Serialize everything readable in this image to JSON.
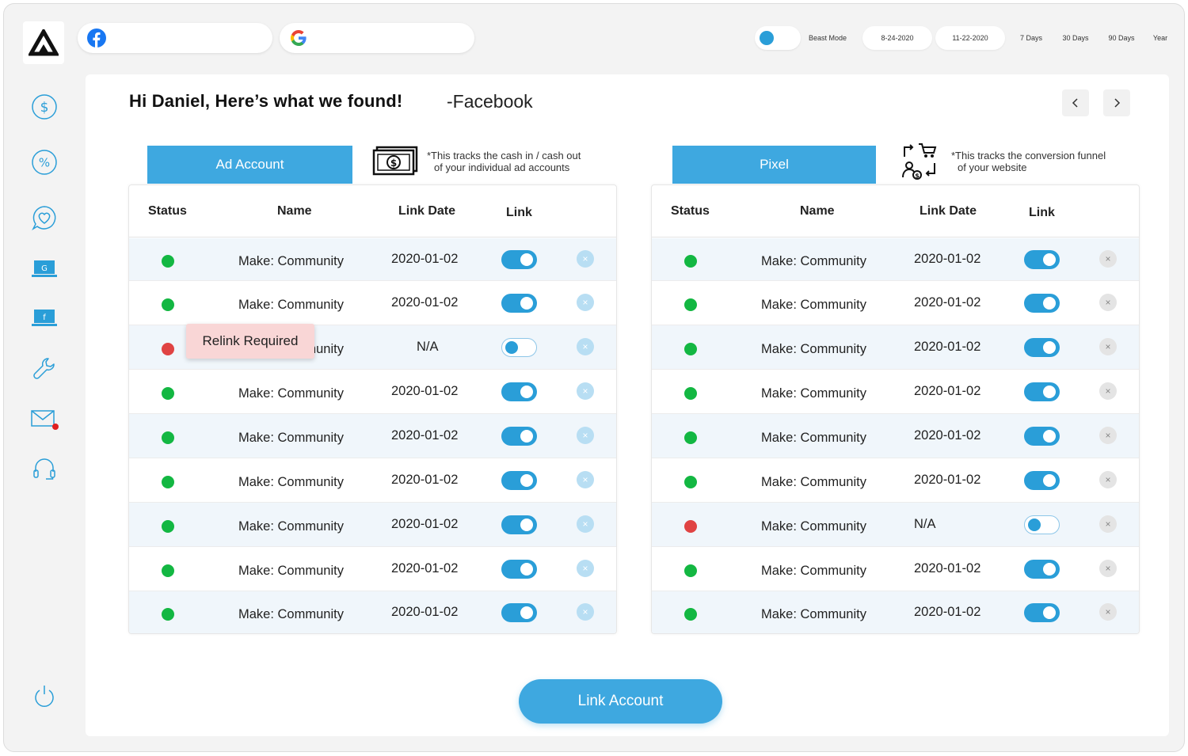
{
  "topbar": {
    "beast_mode_label": "Beast Mode",
    "date_start": "8-24-2020",
    "date_end": "11-22-2020",
    "ranges": [
      "7 Days",
      "30 Days",
      "90 Days",
      "Year"
    ]
  },
  "sidebar": {
    "items": [
      "dollar-icon",
      "percent-icon",
      "heart-chat-icon",
      "google-ads-icon",
      "facebook-ads-icon",
      "wrench-icon",
      "mail-icon",
      "headset-icon"
    ],
    "bottom": "power-icon"
  },
  "header": {
    "greeting": "Hi Daniel, Here’s what we found!",
    "platform": "-Facebook"
  },
  "ad_account": {
    "tab_label": "Ad Account",
    "note_line1": "*This tracks the cash in / cash out",
    "note_line2": "of your individual ad accounts",
    "columns": [
      "Status",
      "Name",
      "Link Date",
      "Link"
    ],
    "tooltip": "Relink Required",
    "rows": [
      {
        "status": "green",
        "name": "Make: Community",
        "date": "2020-01-02",
        "linked": true
      },
      {
        "status": "green",
        "name": "Make: Community",
        "date": "2020-01-02",
        "linked": true
      },
      {
        "status": "red",
        "name": "Make: Community",
        "date": "N/A",
        "linked": false
      },
      {
        "status": "green",
        "name": "Make: Community",
        "date": "2020-01-02",
        "linked": true
      },
      {
        "status": "green",
        "name": "Make: Community",
        "date": "2020-01-02",
        "linked": true
      },
      {
        "status": "green",
        "name": "Make: Community",
        "date": "2020-01-02",
        "linked": true
      },
      {
        "status": "green",
        "name": "Make: Community",
        "date": "2020-01-02",
        "linked": true
      },
      {
        "status": "green",
        "name": "Make: Community",
        "date": "2020-01-02",
        "linked": true
      },
      {
        "status": "green",
        "name": "Make: Community",
        "date": "2020-01-02",
        "linked": true
      }
    ]
  },
  "pixel": {
    "tab_label": "Pixel",
    "note_line1": "*This tracks the conversion funnel",
    "note_line2": "of your website",
    "columns": [
      "Status",
      "Name",
      "Link Date",
      "Link"
    ],
    "rows": [
      {
        "status": "green",
        "name": "Make: Community",
        "date": "2020-01-02",
        "linked": true
      },
      {
        "status": "green",
        "name": "Make: Community",
        "date": "2020-01-02",
        "linked": true
      },
      {
        "status": "green",
        "name": "Make: Community",
        "date": "2020-01-02",
        "linked": true
      },
      {
        "status": "green",
        "name": "Make: Community",
        "date": "2020-01-02",
        "linked": true
      },
      {
        "status": "green",
        "name": "Make: Community",
        "date": "2020-01-02",
        "linked": true
      },
      {
        "status": "green",
        "name": "Make: Community",
        "date": "2020-01-02",
        "linked": true
      },
      {
        "status": "red",
        "name": "Make: Community",
        "date": "N/A",
        "linked": false
      },
      {
        "status": "green",
        "name": "Make: Community",
        "date": "2020-01-02",
        "linked": true
      },
      {
        "status": "green",
        "name": "Make: Community",
        "date": "2020-01-02",
        "linked": true
      }
    ]
  },
  "footer": {
    "link_account_label": "Link Account"
  },
  "colors": {
    "accent": "#3ea8e0",
    "toggle": "#2a9ed8",
    "status_green": "#13b742",
    "status_red": "#e04343",
    "tooltip_bg": "#f9d6d6"
  }
}
